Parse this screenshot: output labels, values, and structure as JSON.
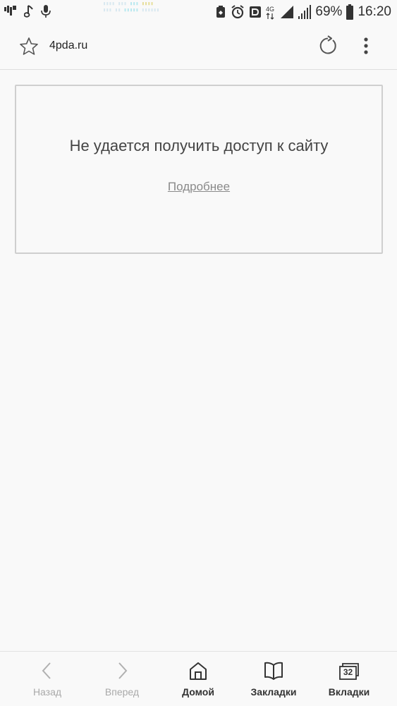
{
  "status_bar": {
    "battery_percent": "69%",
    "time": "16:20",
    "network_type": "4G",
    "left_icons": [
      "carrier-logo-icon",
      "music-note-icon",
      "microphone-icon"
    ],
    "right_icons": [
      "battery-saver-icon",
      "alarm-icon",
      "nfc-icon",
      "network-4g-icon",
      "signal-icon",
      "signal-bars-icon",
      "battery-icon"
    ]
  },
  "url_bar": {
    "url": "4pda.ru",
    "icons": [
      "star-icon",
      "reload-icon",
      "more-vert-icon"
    ]
  },
  "error": {
    "title": "Не удается получить доступ к сайту",
    "details_link": "Подробнее"
  },
  "bottom_nav": {
    "back_label": "Назад",
    "forward_label": "Вперед",
    "home_label": "Домой",
    "bookmarks_label": "Закладки",
    "tabs_label": "Вкладки",
    "tabs_count": "32"
  },
  "colors": {
    "background": "#f9f9f9",
    "text": "#333333",
    "disabled": "#a9a9a9",
    "border": "#cfcfcf"
  }
}
